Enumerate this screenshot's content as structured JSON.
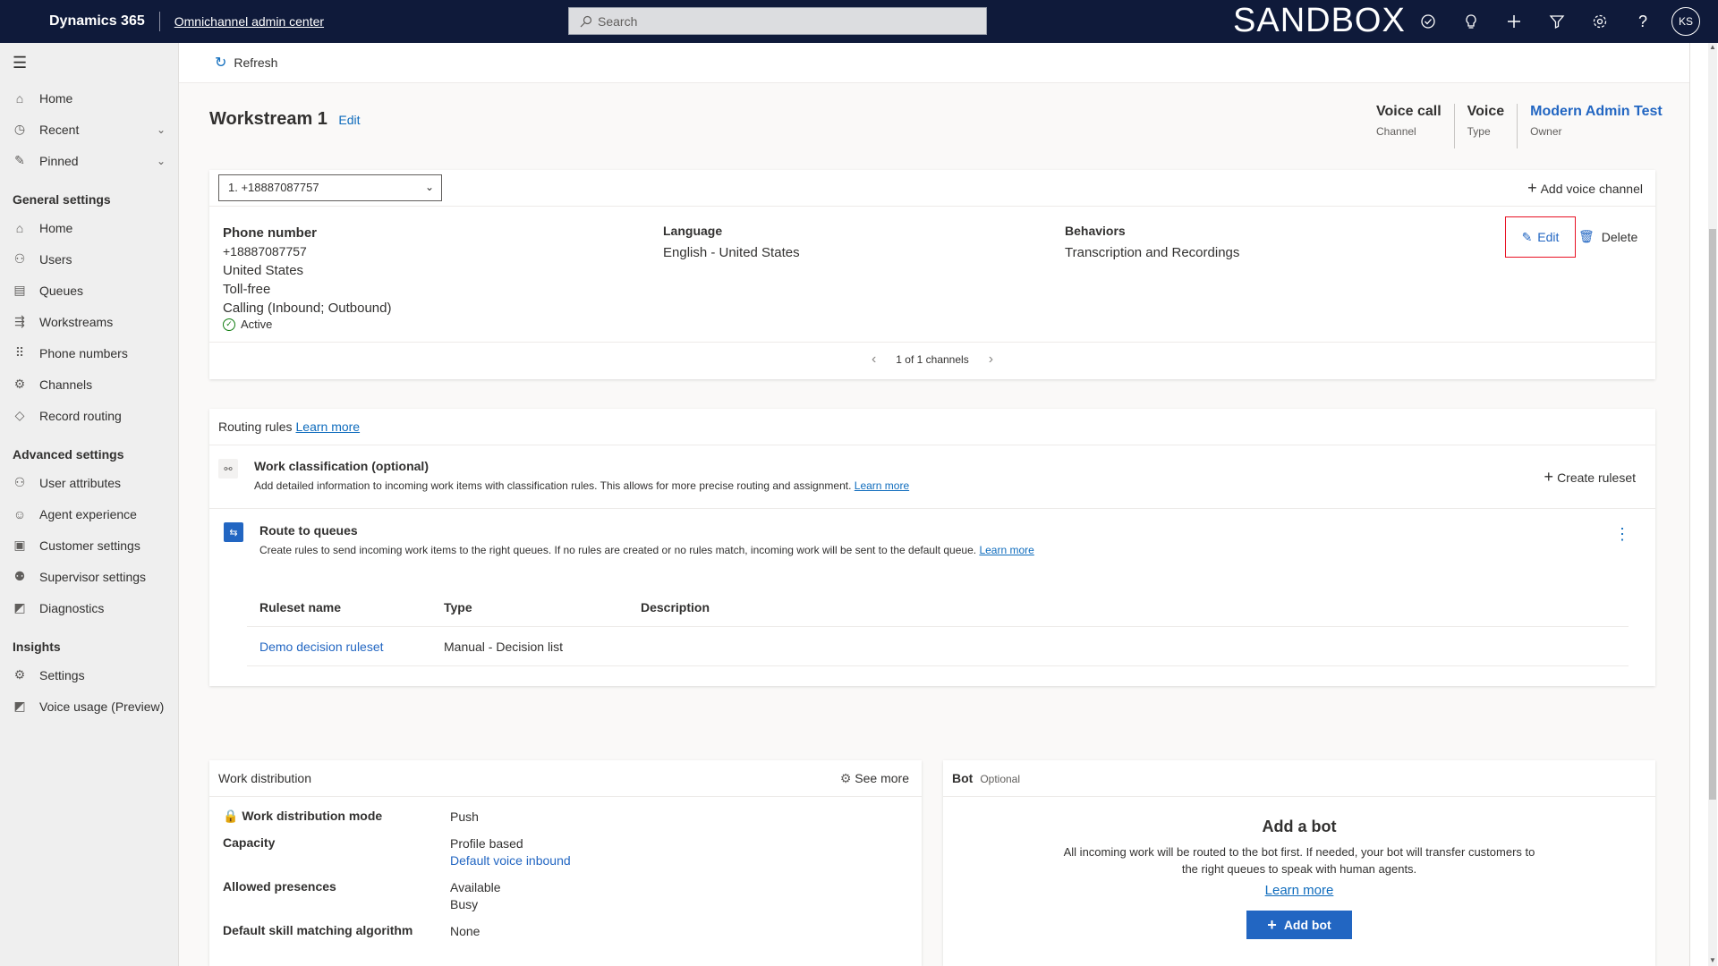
{
  "topbar": {
    "brand": "Dynamics 365",
    "app_name": "Omnichannel admin center",
    "search_placeholder": "Search",
    "environment": "SANDBOX",
    "avatar_initials": "KS",
    "icons": [
      "task-icon",
      "lightbulb-icon",
      "plus-icon",
      "filter-icon",
      "gear-icon",
      "help-icon"
    ]
  },
  "sidebar": {
    "top_items": [
      {
        "label": "Home",
        "icon": "home-icon"
      },
      {
        "label": "Recent",
        "icon": "clock-icon"
      },
      {
        "label": "Pinned",
        "icon": "pin-icon"
      }
    ],
    "general_heading": "General settings",
    "general_items": [
      {
        "label": "Home",
        "icon": "home-icon"
      },
      {
        "label": "Users",
        "icon": "users-icon"
      },
      {
        "label": "Queues",
        "icon": "queues-icon"
      },
      {
        "label": "Workstreams",
        "icon": "workstreams-icon"
      },
      {
        "label": "Phone numbers",
        "icon": "dialpad-icon"
      },
      {
        "label": "Channels",
        "icon": "channels-icon"
      },
      {
        "label": "Record routing",
        "icon": "routing-icon"
      }
    ],
    "advanced_heading": "Advanced settings",
    "advanced_items": [
      {
        "label": "User attributes",
        "icon": "user-attributes-icon"
      },
      {
        "label": "Agent experience",
        "icon": "agent-icon"
      },
      {
        "label": "Customer settings",
        "icon": "customer-icon"
      },
      {
        "label": "Supervisor settings",
        "icon": "supervisor-icon"
      },
      {
        "label": "Diagnostics",
        "icon": "diagnostics-icon"
      }
    ],
    "insights_heading": "Insights",
    "insights_items": [
      {
        "label": "Settings",
        "icon": "gear-icon"
      },
      {
        "label": "Voice usage (Preview)",
        "icon": "chart-icon"
      }
    ]
  },
  "cmdbar": {
    "refresh_label": "Refresh"
  },
  "header": {
    "title": "Workstream 1",
    "edit_label": "Edit",
    "meta": [
      {
        "value": "Voice call",
        "label": "Channel"
      },
      {
        "value": "Voice",
        "label": "Type"
      },
      {
        "value": "Modern Admin Test",
        "label": "Owner"
      }
    ]
  },
  "channel": {
    "selected_number": "1. +18887087757",
    "add_voice_channel": "Add voice channel",
    "phone_label": "Phone number",
    "phone_lines": [
      "+18887087757",
      "United States",
      "Toll-free",
      "Calling (Inbound; Outbound)"
    ],
    "status": "Active",
    "language_label": "Language",
    "language_value": "English - United States",
    "behaviors_label": "Behaviors",
    "behaviors_value": "Transcription and Recordings",
    "edit_label": "Edit",
    "delete_label": "Delete",
    "pager_text": "1 of 1 channels"
  },
  "routing": {
    "title": "Routing rules",
    "learn_more": "Learn more",
    "wc_title": "Work classification (optional)",
    "wc_desc": "Add detailed information to incoming work items with classification rules. This allows for more precise routing and assignment.",
    "wc_learn_more": "Learn more",
    "create_ruleset": "Create ruleset",
    "rq_title": "Route to queues",
    "rq_desc": "Create rules to send incoming work items to the right queues. If no rules are created or no rules match, incoming work will be sent to the default queue.",
    "rq_learn_more": "Learn more",
    "table": {
      "headers": [
        "Ruleset name",
        "Type",
        "Description"
      ],
      "rows": [
        {
          "name": "Demo decision ruleset",
          "type": "Manual - Decision list",
          "description": ""
        }
      ]
    }
  },
  "work_distribution": {
    "title": "Work distribution",
    "see_more": "See more",
    "rows": [
      {
        "key": "Work distribution mode",
        "values": [
          "Push"
        ]
      },
      {
        "key": "Capacity",
        "values": [
          "Profile based",
          "Default voice inbound"
        ]
      },
      {
        "key": "Allowed presences",
        "values": [
          "Available",
          "Busy"
        ]
      },
      {
        "key": "Default skill matching algorithm",
        "values": [
          "None"
        ]
      }
    ]
  },
  "bot": {
    "title": "Bot",
    "optional": "Optional",
    "heading": "Add a bot",
    "desc": "All incoming work will be routed to the bot first. If needed, your bot will transfer customers to the right queues to speak with human agents.",
    "learn_more": "Learn more",
    "add_bot": "Add bot"
  }
}
